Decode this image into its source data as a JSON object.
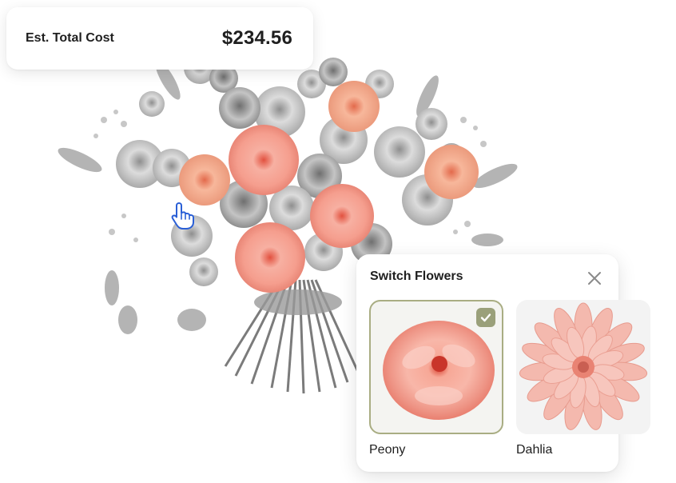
{
  "cost_card": {
    "label": "Est. Total Cost",
    "value": "$234.56"
  },
  "switch_panel": {
    "title": "Switch Flowers",
    "close_icon": "close-icon",
    "options": [
      {
        "label": "Peony",
        "selected": true,
        "icon": "peony-image"
      },
      {
        "label": "Dahlia",
        "selected": false,
        "icon": "dahlia-image"
      }
    ]
  },
  "colors": {
    "accent_selected": "#a9ad83",
    "check_badge": "#9aa07a",
    "peony": "#f3a79a",
    "dahlia": "#f2b3aa"
  }
}
